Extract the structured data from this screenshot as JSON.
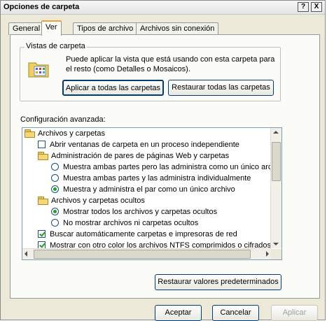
{
  "window": {
    "title": "Opciones de carpeta",
    "help_glyph": "?",
    "close_glyph": "X"
  },
  "tabs": [
    {
      "label": "General",
      "active": false
    },
    {
      "label": "Ver",
      "active": true
    },
    {
      "label": "Tipos de archivo",
      "active": false
    },
    {
      "label": "Archivos sin conexión",
      "active": false
    }
  ],
  "folder_views": {
    "group_label": "Vistas de carpeta",
    "description": "Puede aplicar la vista que está usando con esta carpeta para el resto (como Detalles o Mosaicos).",
    "apply_all_label": "Aplicar a todas las carpetas",
    "reset_all_label": "Restaurar todas las carpetas"
  },
  "advanced": {
    "label": "Configuración avanzada:",
    "items": [
      {
        "type": "folder",
        "text": "Archivos y carpetas"
      },
      {
        "type": "checkbox",
        "checked": false,
        "text": "Abrir ventanas de carpeta  en un proceso independiente"
      },
      {
        "type": "folder",
        "text": "Administración de pares de páginas Web y carpetas"
      },
      {
        "type": "radio",
        "checked": false,
        "text": "Muestra ambas partes pero las administra como un único archivo"
      },
      {
        "type": "radio",
        "checked": false,
        "text": "Muestra ambas partes y las administra individualmente"
      },
      {
        "type": "radio",
        "checked": true,
        "text": "Muestra y administra el par como un único archivo"
      },
      {
        "type": "folder",
        "text": "Archivos y carpetas ocultos"
      },
      {
        "type": "radio",
        "checked": true,
        "text": "Mostrar todos los archivos y carpetas ocultos"
      },
      {
        "type": "radio",
        "checked": false,
        "text": "No mostrar archivos ni carpetas ocultos"
      },
      {
        "type": "checkbox",
        "checked": true,
        "text": "Buscar automáticamente carpetas e impresoras de red"
      },
      {
        "type": "checkbox",
        "checked": true,
        "text": "Mostrar con otro color los archivos NTFS comprimidos o cifrados"
      }
    ],
    "restore_defaults_label": "Restaurar valores predeterminados"
  },
  "footer": {
    "ok_label": "Aceptar",
    "cancel_label": "Cancelar",
    "apply_label": "Aplicar"
  },
  "colors": {
    "accent_tab": "#e8a33a",
    "check_green": "#21a121",
    "button_border": "#003c74"
  }
}
